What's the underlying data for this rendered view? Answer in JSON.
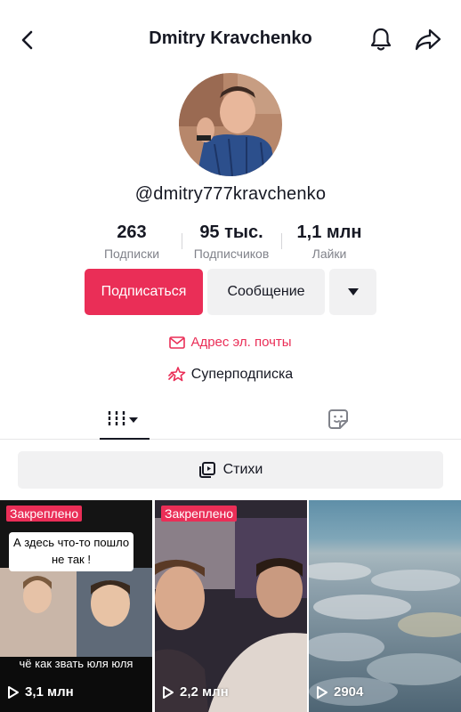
{
  "header": {
    "title": "Dmitry Kravchenko",
    "back_icon": "chevron-left-icon",
    "bell_icon": "bell-icon",
    "share_icon": "share-arrow-icon"
  },
  "profile": {
    "username": "@dmitry777kravchenko",
    "stats": [
      {
        "value": "263",
        "label": "Подписки"
      },
      {
        "value": "95 тыс.",
        "label": "Подписчиков"
      },
      {
        "value": "1,1 млн",
        "label": "Лайки"
      }
    ]
  },
  "actions": {
    "follow_label": "Подписаться",
    "message_label": "Сообщение",
    "more_icon": "caret-down-icon"
  },
  "links": {
    "email_label": "Адрес эл. почты",
    "superfollow_label": "Суперподписка"
  },
  "tabs": {
    "videos_icon": "grid-icon",
    "stickers_icon": "sticker-icon"
  },
  "playlist": {
    "label": "Стихи"
  },
  "videos": [
    {
      "pinned": "Закреплено",
      "caption": "А здесь что-то пошло не так !",
      "subtitle": "чё как звать юля юля",
      "views": "3,1 млн"
    },
    {
      "pinned": "Закреплено",
      "views": "2,2 млн"
    },
    {
      "views": "2904"
    }
  ],
  "colors": {
    "accent": "#ea2e57",
    "text": "#161823",
    "muted": "#80828a",
    "button_bg": "#f1f1f2"
  }
}
